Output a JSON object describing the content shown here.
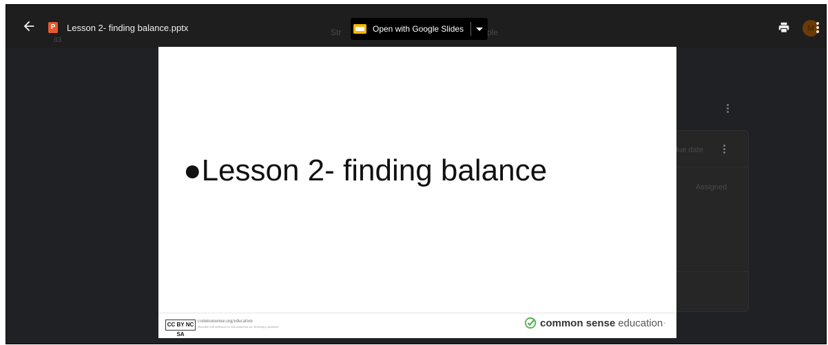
{
  "viewer": {
    "file_name": "Lesson 2- finding balance.pptx",
    "file_icon_letter": "P",
    "open_with_label": "Open with Google Slides",
    "avatar_letter": "M"
  },
  "background_page": {
    "obscured_left": "Str",
    "obscured_right": "ple",
    "small_label": "83",
    "column_header": "due date",
    "status": "Assigned"
  },
  "slide": {
    "bullet": "●",
    "title": "Lesson 2- finding balance",
    "footer_url": "commonsense.org/education",
    "footer_license": "Shareable with attribution for noncommercial use. Remixing is permitted.",
    "cc_label": "CC BY NC SA",
    "brand_bold": "common sense",
    "brand_light": "education",
    "brand_mark": "·"
  },
  "icons": {
    "back": "back-arrow-icon",
    "print": "printer-icon",
    "more": "more-vert-icon",
    "slides": "google-slides-icon",
    "caret": "dropdown-caret-icon",
    "check": "checkmark-circle-icon"
  },
  "colors": {
    "file_icon": "#e8582c",
    "slides_yellow": "#f5b400",
    "check_green": "#4caf50"
  }
}
